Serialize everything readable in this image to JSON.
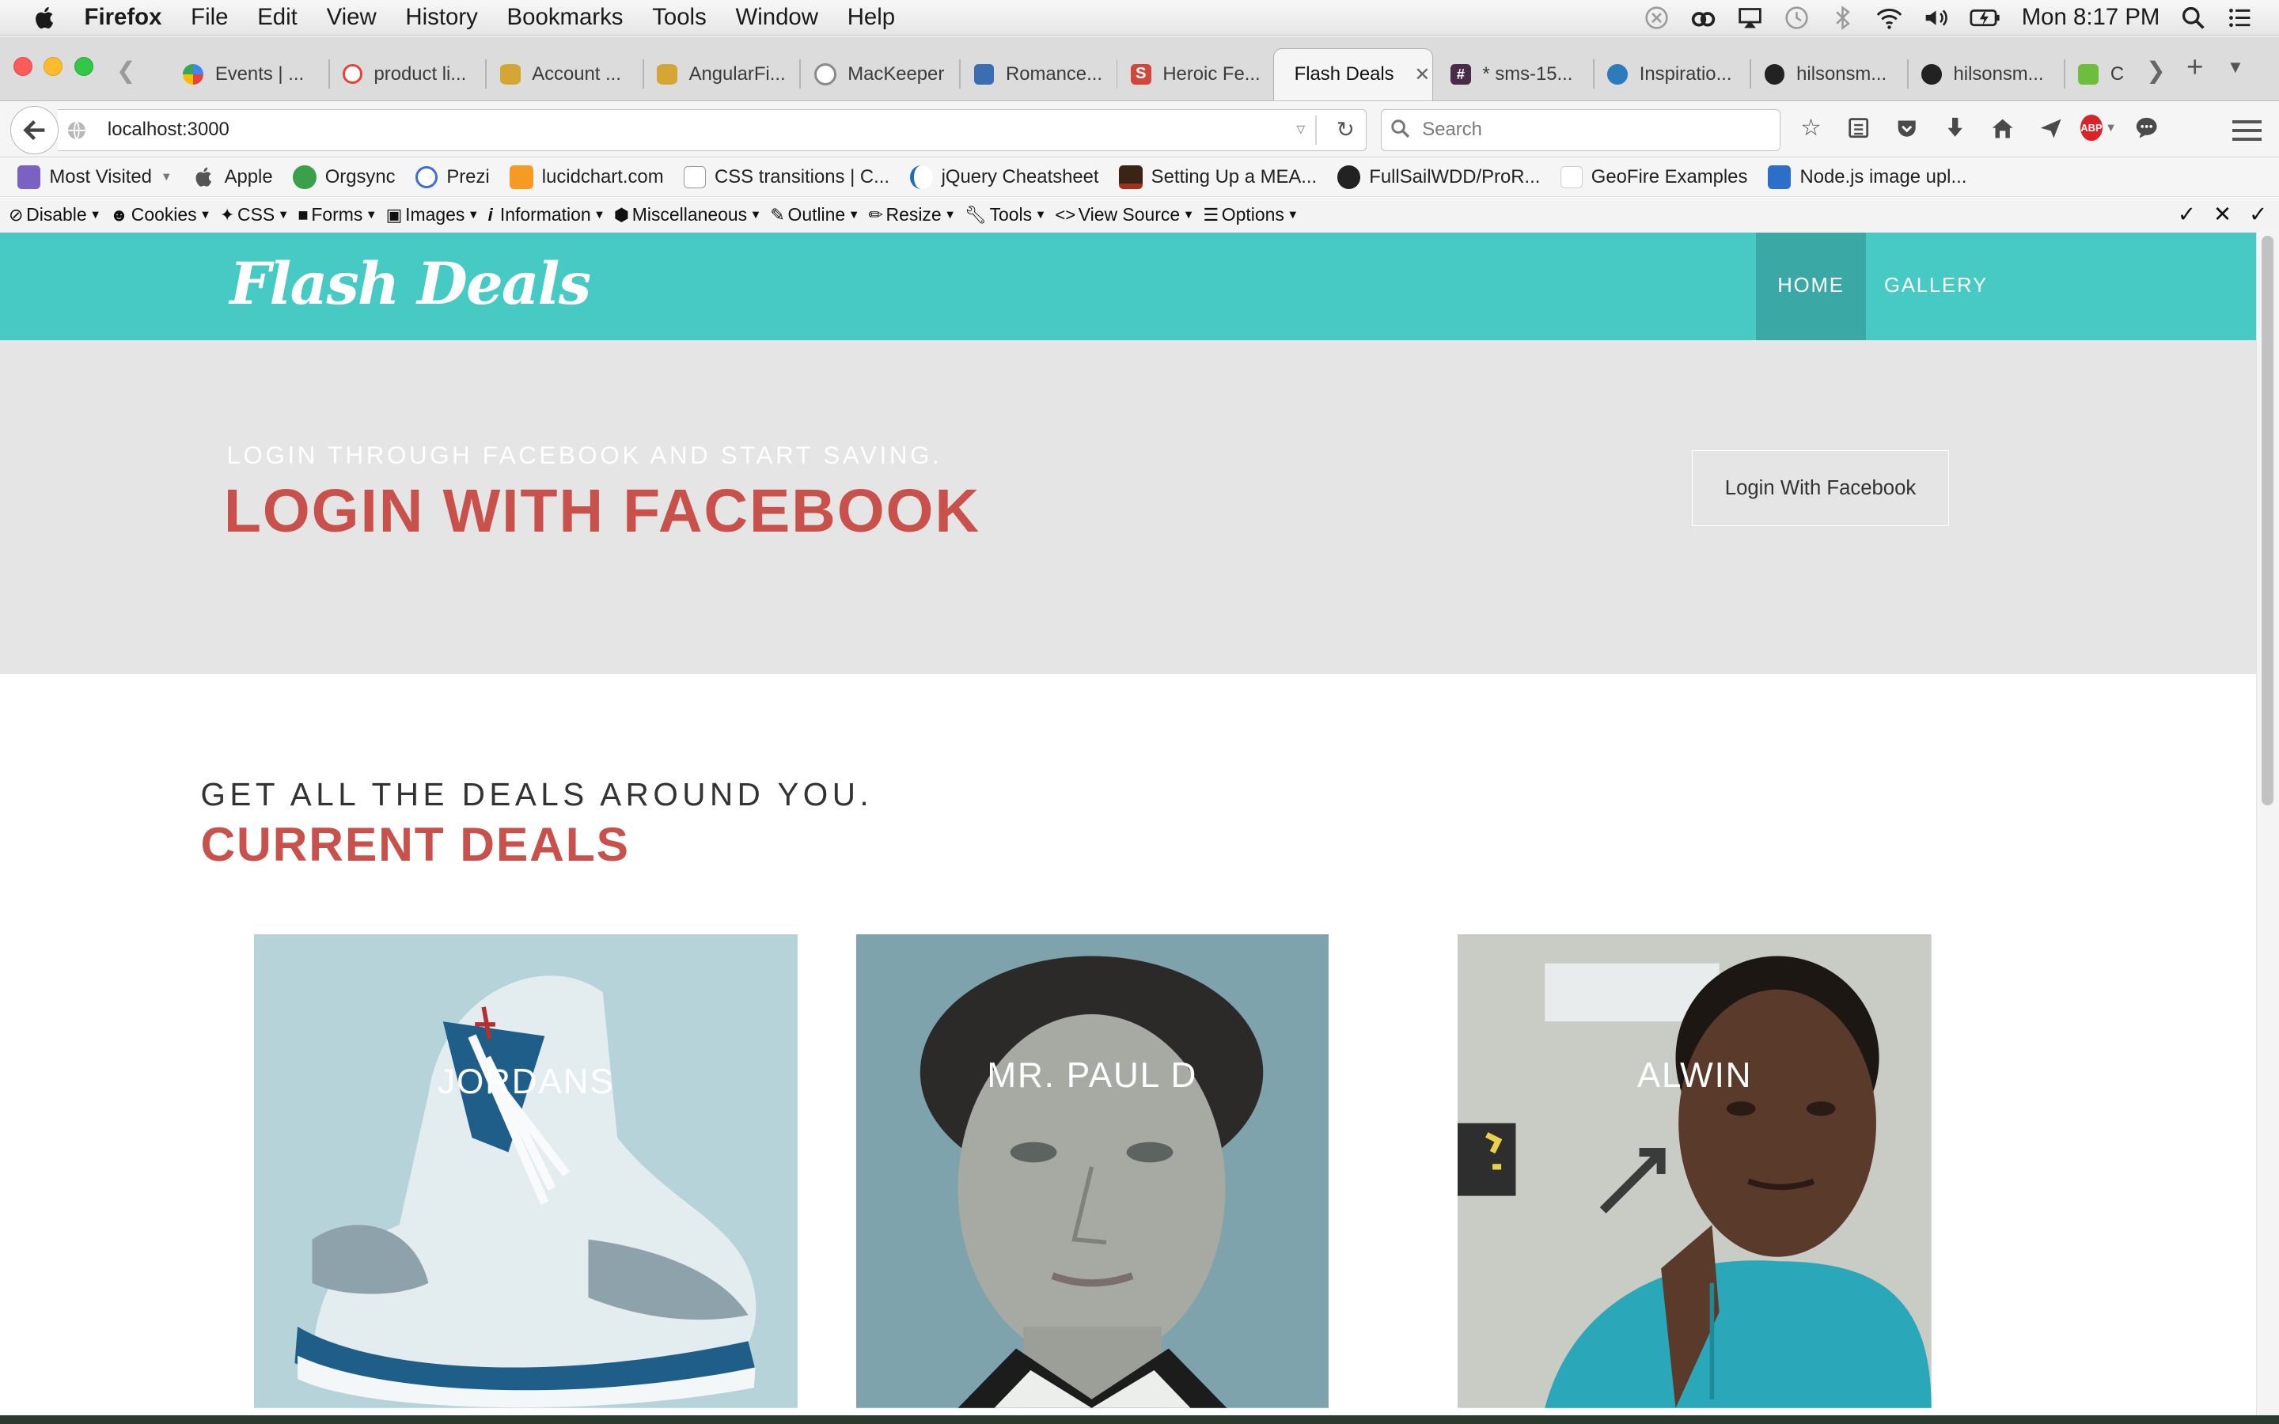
{
  "menubar": {
    "app_name": "Firefox",
    "items": [
      "File",
      "Edit",
      "View",
      "History",
      "Bookmarks",
      "Tools",
      "Window",
      "Help"
    ],
    "clock": "Mon 8:17 PM"
  },
  "tabs": [
    {
      "label": "Events | ...",
      "icon": "google-icon",
      "color": "#4285f4"
    },
    {
      "label": "product li...",
      "icon": "google-g-icon",
      "color": "#ea4335"
    },
    {
      "label": "Account ...",
      "icon": "database-icon",
      "color": "#d4a634"
    },
    {
      "label": "AngularFi...",
      "icon": "database-icon",
      "color": "#d4a634"
    },
    {
      "label": "MacKeeper",
      "icon": "mackeeper-icon",
      "color": "#8a8a8a"
    },
    {
      "label": "Romance...",
      "icon": "film-icon",
      "color": "#3b6db3"
    },
    {
      "label": "Heroic Fe...",
      "icon": "s-icon",
      "color": "#d0473c"
    },
    {
      "label": "Flash Deals",
      "icon": "",
      "color": "#ffffff",
      "active": true
    },
    {
      "label": "* sms-15...",
      "icon": "slack-hash-icon",
      "color": "#4a2c4a"
    },
    {
      "label": "Inspiratio...",
      "icon": "drop-icon",
      "color": "#2c7bbd"
    },
    {
      "label": "hilsonsm...",
      "icon": "github-icon",
      "color": "#222222"
    },
    {
      "label": "hilsonsm...",
      "icon": "github-icon",
      "color": "#222222"
    },
    {
      "label": "C",
      "icon": "w3-icon",
      "color": "#6dbf3b"
    }
  ],
  "navbar": {
    "url": "localhost:3000",
    "search_placeholder": "Search"
  },
  "bookmarks": [
    {
      "label": "Most Visited",
      "icon": "most-visited-icon",
      "color": "#7b61c4",
      "dropdown": true
    },
    {
      "label": "Apple",
      "icon": "apple-icon",
      "color": "#555555"
    },
    {
      "label": "Orgsync",
      "icon": "orgsync-icon",
      "color": "#3aa04a"
    },
    {
      "label": "Prezi",
      "icon": "prezi-icon",
      "color": "#3c6fd1"
    },
    {
      "label": "lucidchart.com",
      "icon": "lucidchart-icon",
      "color": "#f59a23"
    },
    {
      "label": "CSS transitions | C...",
      "icon": "css3-icon",
      "color": "#9a9a9a"
    },
    {
      "label": "jQuery Cheatsheet",
      "icon": "jquery-icon",
      "color": "#1f6fb5"
    },
    {
      "label": "Setting Up a MEA...",
      "icon": "flame-icon",
      "color": "#a3301d"
    },
    {
      "label": "FullSailWDD/ProR...",
      "icon": "github-icon",
      "color": "#222222"
    },
    {
      "label": "GeoFire Examples",
      "icon": "blank-page-icon",
      "color": "#e8e8e8"
    },
    {
      "label": "Node.js image upl...",
      "icon": "node-icon",
      "color": "#2b6fc9"
    }
  ],
  "devbar": [
    "Disable",
    "Cookies",
    "CSS",
    "Forms",
    "Images",
    "Information",
    "Miscellaneous",
    "Outline",
    "Resize",
    "Tools",
    "View Source",
    "Options"
  ],
  "site": {
    "logo": "Flash Deals",
    "nav": {
      "home": "HOME",
      "gallery": "GALLERY"
    },
    "hero": {
      "subtitle": "Login through Facebook and start saving.",
      "title": "Login With Facebook",
      "button": "Login With Facebook"
    },
    "deals": {
      "subtitle": "Get all the deals around you.",
      "title": "Current Deals",
      "cards": [
        {
          "label": "JORDANS"
        },
        {
          "label": "MR. PAUL D"
        },
        {
          "label": "ALWIN"
        }
      ]
    }
  },
  "colors": {
    "teal": "#47c9c4",
    "teal_dark": "#3aa8a4",
    "accent_red": "#c9514b",
    "hero_bg": "#e5e5e5"
  }
}
